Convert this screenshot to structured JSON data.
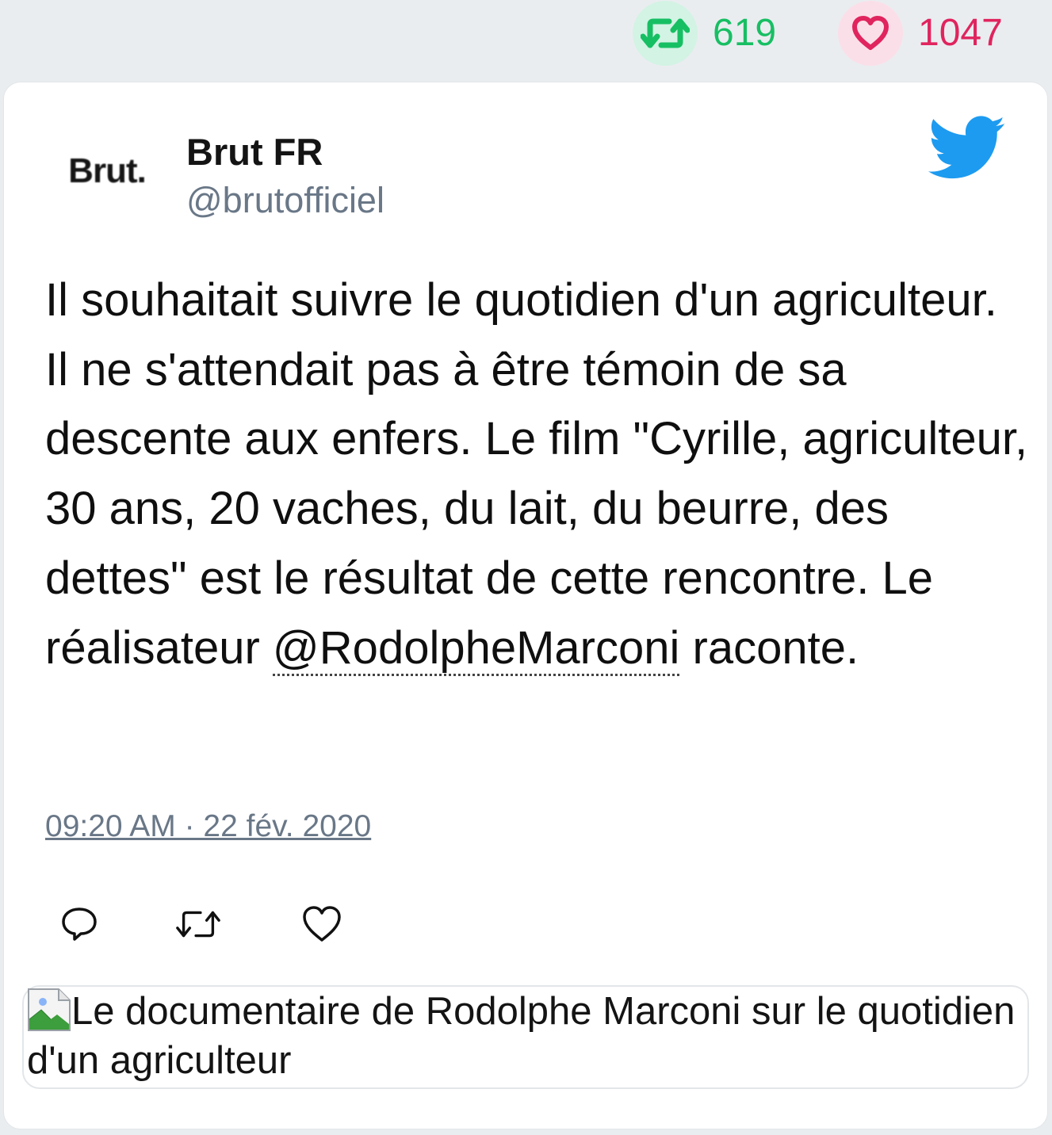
{
  "stats": {
    "retweet_count": "619",
    "like_count": "1047",
    "retweet_icon": "retweet-icon",
    "like_icon": "heart-icon"
  },
  "author": {
    "avatar_text": "Brut.",
    "name": "Brut FR",
    "handle": "@brutofficiel"
  },
  "tweet": {
    "text_before_mention": "Il souhaitait suivre le quotidien d'un agriculteur. Il ne s'attendait pas à être témoin de sa descente aux enfers. Le film \"Cyrille, agriculteur, 30 ans, 20 vaches, du lait, du beurre, des dettes\" est le résultat de cette rencontre. Le réalisateur ",
    "mention": "@RodolpheMarconi",
    "text_after_mention": " raconte.",
    "timestamp": "09:20 AM · 22 fév. 2020"
  },
  "media": {
    "alt_text": "Le documentaire de Rodolphe Marconi sur le quotidien d'un agriculteur"
  },
  "colors": {
    "retweet_green": "#17bf63",
    "like_red": "#e0245e",
    "twitter_blue": "#1d9bf0",
    "muted_text": "#697787"
  }
}
